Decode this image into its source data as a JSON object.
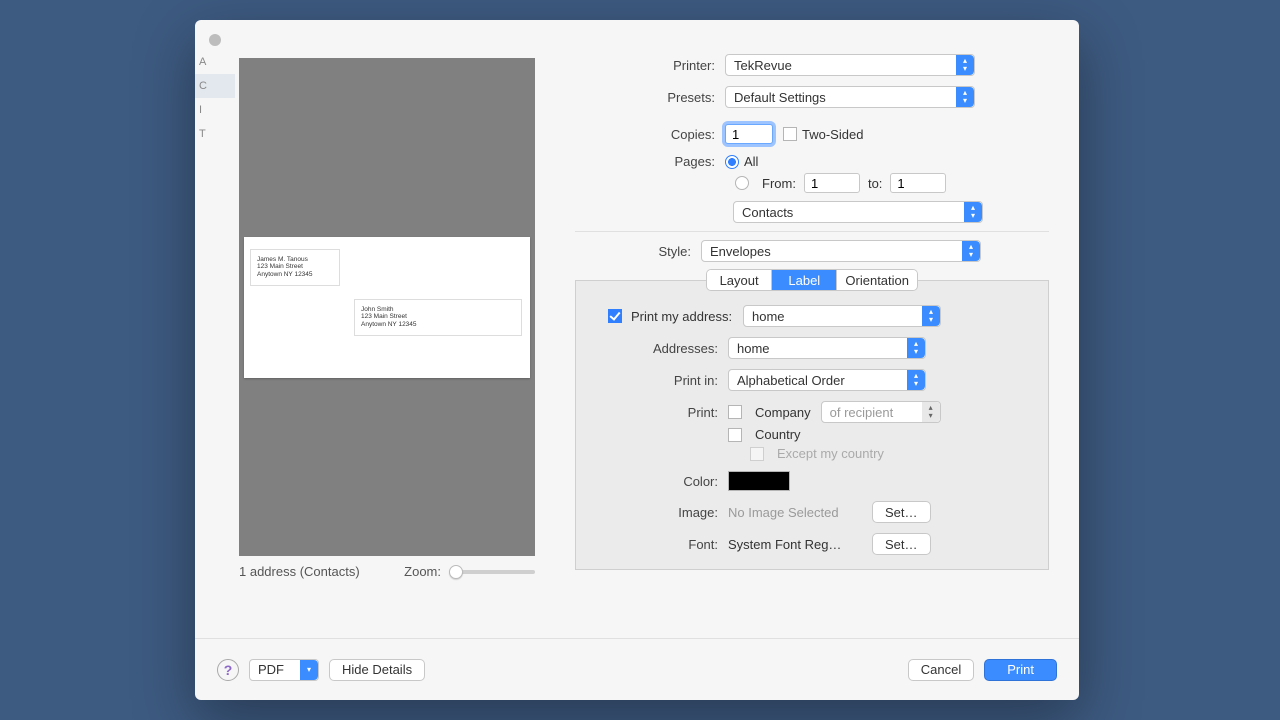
{
  "dialog": {
    "printer_label": "Printer:",
    "printer_value": "TekRevue",
    "presets_label": "Presets:",
    "presets_value": "Default Settings",
    "copies_label": "Copies:",
    "copies_value": "1",
    "two_sided_label": "Two-Sided",
    "pages_label": "Pages:",
    "pages_all": "All",
    "pages_from": "From:",
    "pages_from_value": "1",
    "pages_to": "to:",
    "pages_to_value": "1",
    "app_dropdown": "Contacts",
    "style_label": "Style:",
    "style_value": "Envelopes"
  },
  "tabs": {
    "layout": "Layout",
    "label": "Label",
    "orientation": "Orientation"
  },
  "label_panel": {
    "print_my_address_label": "Print my address:",
    "print_my_address_value": "home",
    "addresses_label": "Addresses:",
    "addresses_value": "home",
    "print_in_label": "Print in:",
    "print_in_value": "Alphabetical Order",
    "print_label": "Print:",
    "company_label": "Company",
    "of_recipient": "of recipient",
    "country_label": "Country",
    "except_my_country": "Except my country",
    "color_label": "Color:",
    "image_label": "Image:",
    "image_value": "No Image Selected",
    "set_btn": "Set…",
    "font_label": "Font:",
    "font_value": "System Font Reg…"
  },
  "preview": {
    "status": "1 address  (Contacts)",
    "zoom_label": "Zoom:",
    "return_name": "James M. Tanous",
    "return_street": "123 Main Street",
    "return_city": "Anytown NY 12345",
    "dest_name": "John Smith",
    "dest_street": "123 Main Street",
    "dest_city": "Anytown NY 12345"
  },
  "footer": {
    "pdf": "PDF",
    "hide_details": "Hide Details",
    "cancel": "Cancel",
    "print": "Print"
  }
}
